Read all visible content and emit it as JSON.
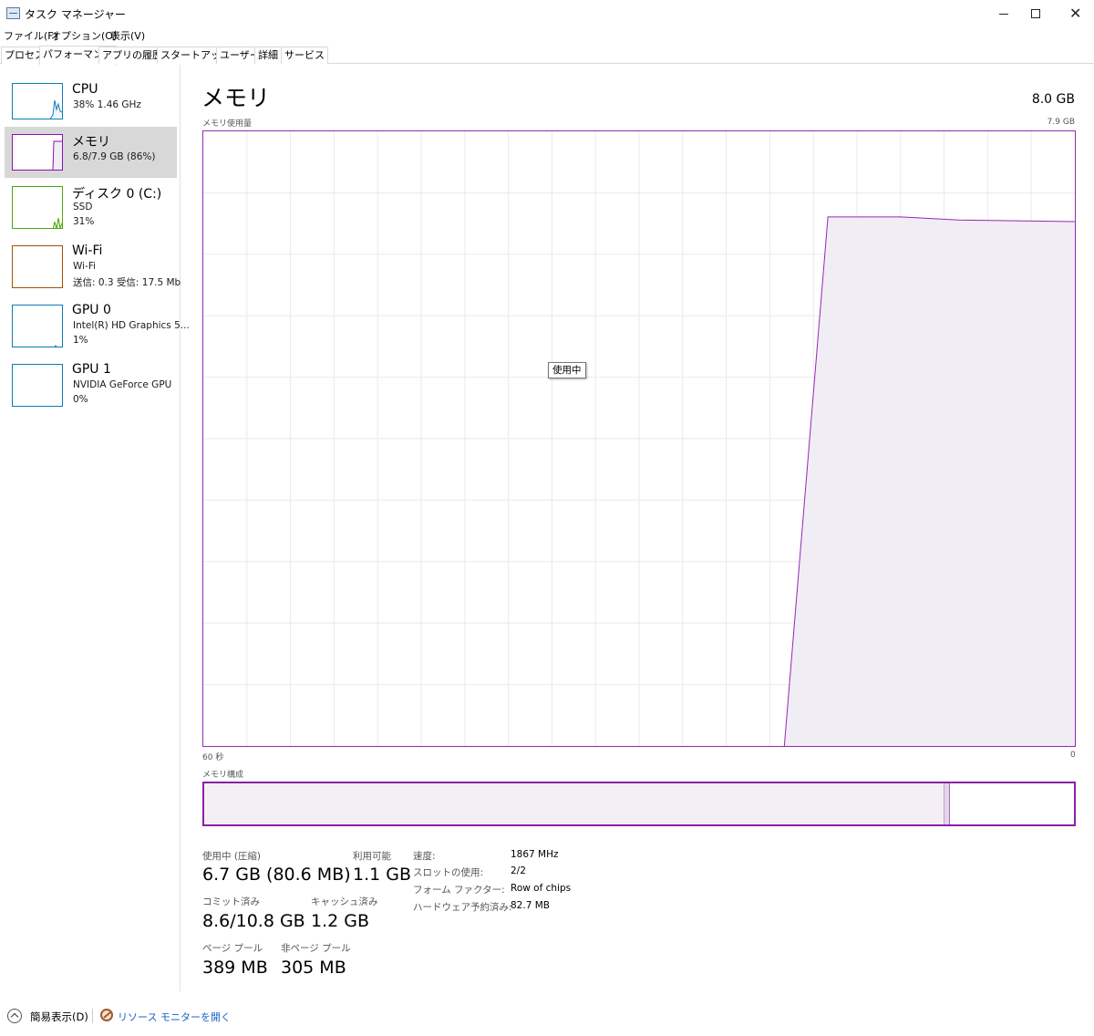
{
  "window": {
    "title": "タスク マネージャー",
    "minimize": "—",
    "maximize": "☐",
    "close": "✕"
  },
  "menu": [
    "ファイル(F)",
    "オプション(O)",
    "表示(V)"
  ],
  "tabs": [
    "プロセス",
    "パフォーマンス",
    "アプリの履歴",
    "スタートアップ",
    "ユーザー",
    "詳細",
    "サービス"
  ],
  "active_tab": "パフォーマンス",
  "sidebar": [
    {
      "name": "CPU",
      "line1": "38%  1.46 GHz",
      "line2": "",
      "color": "#117dbb",
      "icon": "cpu-thumbnail"
    },
    {
      "name": "メモリ",
      "line1": "6.8/7.9 GB (86%)",
      "line2": "",
      "color": "#8b12ae",
      "icon": "memory-thumbnail"
    },
    {
      "name": "ディスク 0 (C:)",
      "line1": "SSD",
      "line2": "31%",
      "color": "#4da60c",
      "icon": "disk-thumbnail"
    },
    {
      "name": "Wi-Fi",
      "line1": "Wi-Fi",
      "line2": "送信: 0.3  受信: 17.5 Mb",
      "color": "#a74f01",
      "icon": "wifi-thumbnail"
    },
    {
      "name": "GPU 0",
      "line1": "Intel(R) HD Graphics 5...",
      "line2": "1%",
      "color": "#0b7bb4",
      "icon": "gpu0-thumbnail"
    },
    {
      "name": "GPU 1",
      "line1": "NVIDIA GeForce GPU",
      "line2": "0%",
      "color": "#0b7bb4",
      "icon": "gpu1-thumbnail"
    }
  ],
  "main": {
    "title": "メモリ",
    "total": "8.0 GB",
    "usage_label": "メモリ使用量",
    "usage_max": "7.9 GB",
    "time_left": "60 秒",
    "time_right": "0",
    "tooltip": "使用中",
    "composition_label": "メモリ構成",
    "composition": {
      "in_use_fraction": 0.851,
      "modified_fraction": 0.006
    }
  },
  "stats": {
    "in_use_label": "使用中 (圧縮)",
    "in_use_value": "6.7 GB (80.6 MB)",
    "available_label": "利用可能",
    "available_value": "1.1 GB",
    "committed_label": "コミット済み",
    "committed_value": "8.6/10.8 GB",
    "cached_label": "キャッシュ済み",
    "cached_value": "1.2 GB",
    "paged_label": "ページ プール",
    "paged_value": "389 MB",
    "nonpaged_label": "非ページ プール",
    "nonpaged_value": "305 MB"
  },
  "details": [
    {
      "key": "速度:",
      "value": "1867 MHz"
    },
    {
      "key": "スロットの使用:",
      "value": "2/2"
    },
    {
      "key": "フォーム ファクター:",
      "value": "Row of chips"
    },
    {
      "key": "ハードウェア予約済み:",
      "value": "82.7 MB"
    }
  ],
  "footer": {
    "fewer_details": "簡易表示(D)",
    "resource_monitor": "リソース モニターを開く"
  },
  "chart_data": {
    "type": "area",
    "x_unit": "seconds ago",
    "x": [
      60,
      20,
      17,
      12,
      8,
      4,
      0
    ],
    "values": [
      null,
      0,
      6.8,
      6.8,
      6.76,
      6.75,
      6.74
    ],
    "ylim": [
      0,
      7.9
    ],
    "xlim": [
      60,
      0
    ],
    "grid": true,
    "line_color": "#9528b4",
    "fill_color": "#f1edf4"
  }
}
